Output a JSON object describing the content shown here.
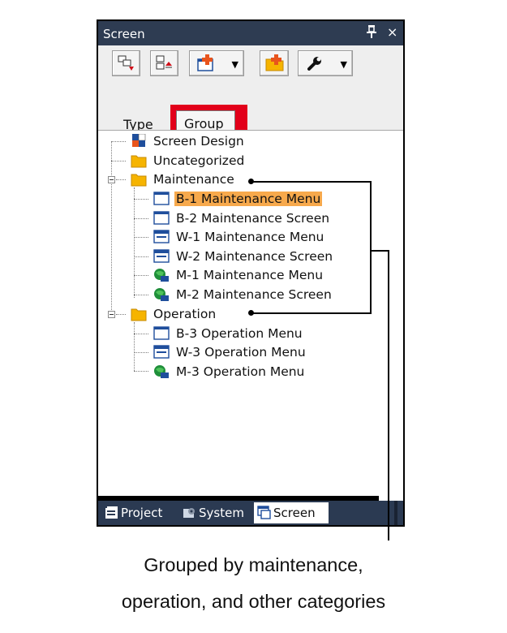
{
  "panel": {
    "title": "Screen",
    "pin_glyph": "📌",
    "close_glyph": "×"
  },
  "toolbar": {
    "buttons": [
      {
        "icon": "move-down-icon"
      },
      {
        "icon": "move-up-icon"
      },
      {
        "icon": "new-screen-icon",
        "has_dropdown": true
      },
      {
        "icon": "new-folder-icon"
      },
      {
        "icon": "wrench-icon",
        "has_dropdown": true
      }
    ],
    "dropdown_glyph": "▼"
  },
  "type_selector": {
    "label": "Type",
    "value": "Group",
    "highlight_color": "#e2001a"
  },
  "tree": {
    "items": [
      {
        "label": "Screen Design",
        "icon": "screen-design-icon"
      },
      {
        "label": "Uncategorized",
        "icon": "folder-icon"
      },
      {
        "label": "Maintenance",
        "icon": "folder-icon",
        "expanded": true
      },
      {
        "label": "B-1 Maintenance Menu",
        "icon": "base-screen-icon",
        "selected": true
      },
      {
        "label": "B-2 Maintenance Screen",
        "icon": "base-screen-icon"
      },
      {
        "label": "W-1 Maintenance Menu",
        "icon": "window-screen-icon"
      },
      {
        "label": "W-2 Maintenance Screen",
        "icon": "window-screen-icon"
      },
      {
        "label": "M-1 Maintenance Menu",
        "icon": "globe-screen-icon"
      },
      {
        "label": "M-2 Maintenance Screen",
        "icon": "globe-screen-icon"
      },
      {
        "label": "Operation",
        "icon": "folder-icon",
        "expanded": true
      },
      {
        "label": "B-3 Operation Menu",
        "icon": "base-screen-icon"
      },
      {
        "label": "W-3 Operation Menu",
        "icon": "window-screen-icon"
      },
      {
        "label": "M-3 Operation Menu",
        "icon": "globe-screen-icon"
      }
    ],
    "selection_color": "#f7a94c"
  },
  "tabs": [
    {
      "label": "Project",
      "icon": "project-icon",
      "active": false
    },
    {
      "label": "System",
      "icon": "system-icon",
      "active": false
    },
    {
      "label": "Screen",
      "icon": "screen-tab-icon",
      "active": true
    }
  ],
  "caption": {
    "line1": "Grouped by maintenance,",
    "line2": "operation, and other categories"
  },
  "colors": {
    "titlebar": "#2e3c52",
    "folder": "#f6b400",
    "tabbar": "#2b3a52"
  }
}
